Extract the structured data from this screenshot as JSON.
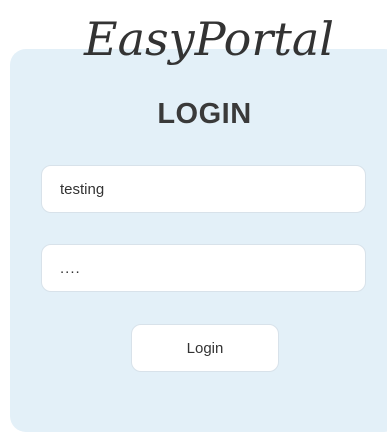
{
  "app": {
    "logo_text": "EasyPortal"
  },
  "login": {
    "title": "LOGIN",
    "username_value": "testing",
    "password_value": "....",
    "submit_label": "Login"
  },
  "colors": {
    "panel_background": "#e3f0f8",
    "title_color": "#3a3a3a",
    "field_border": "#d8e2ea"
  }
}
